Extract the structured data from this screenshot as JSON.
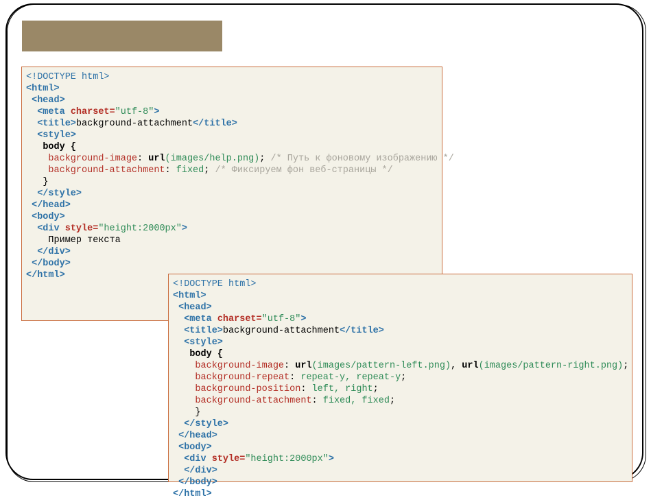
{
  "code1": {
    "doctype": "<!DOCTYPE html>",
    "html_open": "<html>",
    "head_open": "<head>",
    "meta_tag_open": "<meta",
    "meta_attr": "charset=",
    "meta_val": "\"utf-8\"",
    "meta_close": ">",
    "title_open": "<title>",
    "title_text": "background-attachment",
    "title_close": "</title>",
    "style_open": "<style>",
    "body_sel": "body {",
    "p1_name": "background-image",
    "p1_colon": ": ",
    "p1_url_fn": "url",
    "p1_url_arg": "(images/help.png)",
    "p1_semi": ";",
    "p1_comment": " /* Путь к фоновому изображению */",
    "p2_name": "background-attachment",
    "p2_colon": ": ",
    "p2_val": "fixed",
    "p2_semi": ";",
    "p2_comment": " /* Фиксируем фон веб-страницы */",
    "close_brace": "}",
    "style_close": "</style>",
    "head_close": "</head>",
    "body_open": "<body>",
    "div_tag_open": "<div",
    "div_attr": "style=",
    "div_val": "\"height:2000px\"",
    "div_close": ">",
    "div_text": "Пример текста",
    "div_end": "</div>",
    "body_close": "</body>",
    "html_close": "</html>"
  },
  "code2": {
    "doctype": "<!DOCTYPE html>",
    "html_open": "<html>",
    "head_open": "<head>",
    "meta_tag_open": "<meta",
    "meta_attr": "charset=",
    "meta_val": "\"utf-8\"",
    "meta_close": ">",
    "title_open": "<title>",
    "title_text": "background-attachment",
    "title_close": "</title>",
    "style_open": "<style>",
    "body_sel": "body {",
    "p1_name": "background-image",
    "p1_colon": ": ",
    "p1_url1_fn": "url",
    "p1_url1_arg": "(images/pattern-left.png)",
    "p1_sep": ", ",
    "p1_url2_fn": "url",
    "p1_url2_arg": "(images/pattern-right.png)",
    "p1_semi": ";",
    "p2_name": "background-repeat",
    "p2_colon": ": ",
    "p2_val": "repeat-y, repeat-y",
    "p2_semi": ";",
    "p3_name": "background-position",
    "p3_colon": ": ",
    "p3_val": "left, right",
    "p3_semi": ";",
    "p4_name": "background-attachment",
    "p4_colon": ": ",
    "p4_val": "fixed, fixed",
    "p4_semi": ";",
    "close_brace": "}",
    "style_close": "</style>",
    "head_close": "</head>",
    "body_open": "<body>",
    "div_tag_open": "<div",
    "div_attr": "style=",
    "div_val": "\"height:2000px\"",
    "div_close": ">",
    "div_end": "</div>",
    "body_close": "</body>",
    "html_close": "</html>"
  }
}
